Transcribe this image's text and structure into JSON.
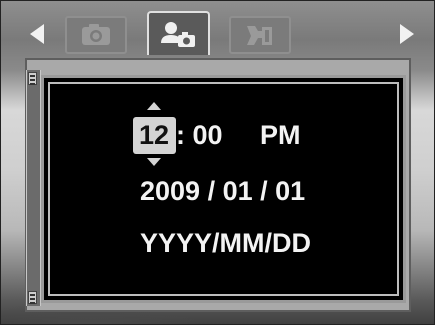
{
  "nav": {
    "tabs": [
      {
        "id": "camera",
        "icon": "camera-icon",
        "selected": false
      },
      {
        "id": "setup",
        "icon": "person-camera-icon",
        "selected": true
      },
      {
        "id": "tools",
        "icon": "wrench-icon",
        "selected": false
      }
    ]
  },
  "datetime": {
    "hour": "12",
    "colon_minute": ": 00",
    "ampm": "PM",
    "date": "2009 / 01 / 01",
    "format": "YYYY/MM/DD"
  },
  "colors": {
    "panel_bg": "#000000",
    "text": "#f3f3f3",
    "highlight": "#d4d4d4"
  }
}
